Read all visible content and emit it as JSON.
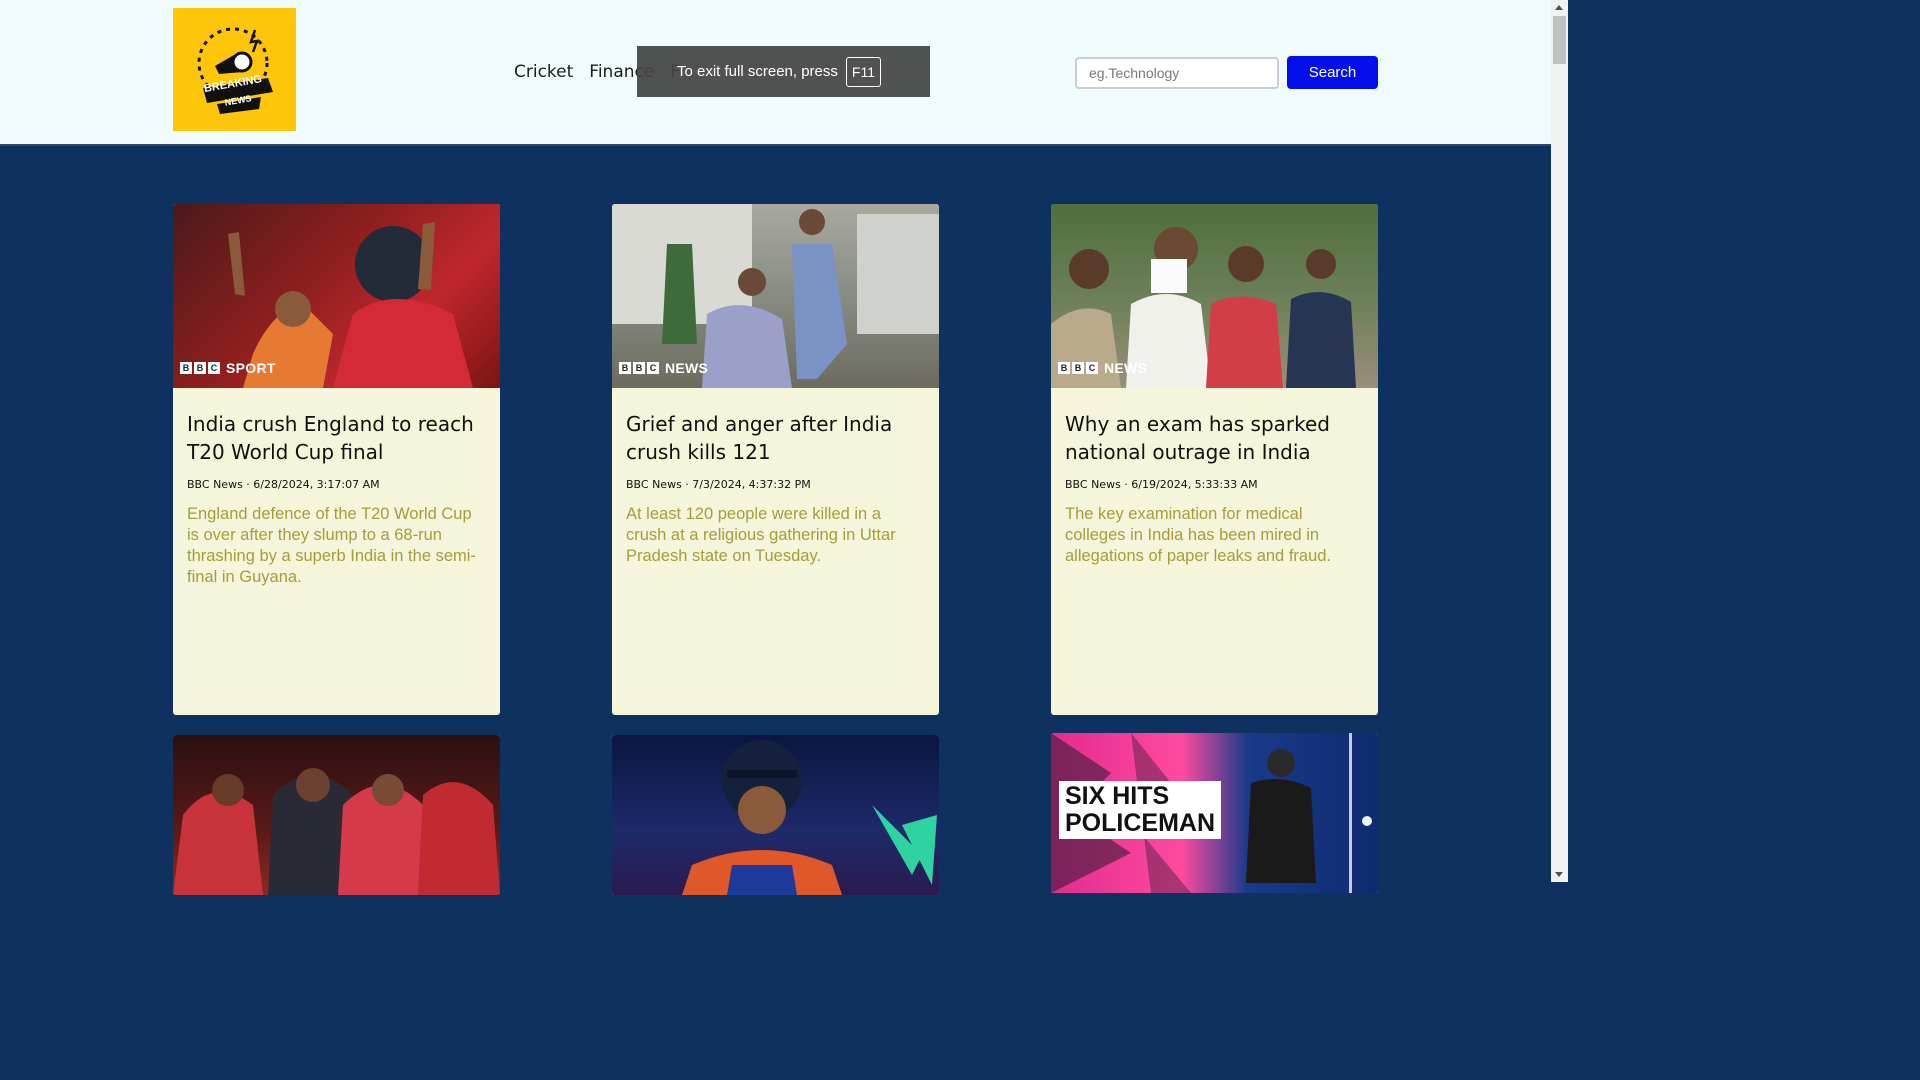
{
  "header": {
    "logo": {
      "line1": "BREAKING",
      "line2": "NEWS"
    },
    "nav": [
      "Cricket",
      "Finance",
      "F"
    ],
    "search": {
      "placeholder": "eg.Technology",
      "button_label": "Search"
    }
  },
  "overlay": {
    "text": "To exit full screen, press",
    "key": "F11"
  },
  "cards": [
    {
      "badge": "SPORT",
      "title": "India crush England to reach T20 World Cup final",
      "meta": "BBC News · 6/28/2024, 3:17:07 AM",
      "description": "England defence of the T20 World Cup is over after they slump to a 68-run thrashing by a superb India in the semi-final in Guyana."
    },
    {
      "badge": "NEWS",
      "title": "Grief and anger after India crush kills 121",
      "meta": "BBC News · 7/3/2024, 4:37:32 PM",
      "description": "At least 120 people were killed in a crush at a religious gathering in Uttar Pradesh state on Tuesday."
    },
    {
      "badge": "NEWS",
      "title": "Why an exam has sparked national outrage in India",
      "meta": "BBC News · 6/19/2024, 5:33:33 AM",
      "description": "The key examination for medical colleges in India has been mired in allegations of paper leaks and fraud."
    }
  ],
  "row2": {
    "six_hits_line1": "SIX HITS",
    "six_hits_line2": "POLICEMAN"
  },
  "colors": {
    "page_bg": "#0f3160",
    "header_bg": "#f0fbfd",
    "card_bg": "#f5f5dc",
    "desc_text": "#a59d3a",
    "search_button": "#0410ec",
    "logo_bg": "#fec60b"
  }
}
